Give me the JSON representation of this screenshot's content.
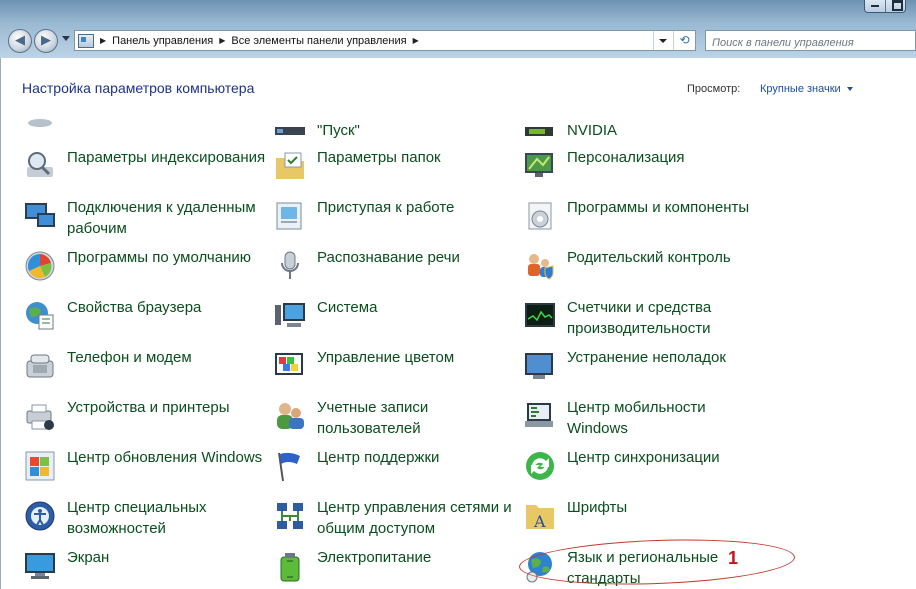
{
  "window": {
    "breadcrumbs": [
      "Панель управления",
      "Все элементы панели управления"
    ],
    "search_placeholder": "Поиск в панели управления"
  },
  "header": {
    "title": "Настройка параметров компьютера",
    "view_label": "Просмотр:",
    "view_value": "Крупные значки"
  },
  "items": [
    {
      "label": "\"Пуск\"",
      "icon": "taskbar-icon"
    },
    {
      "label": "NVIDIA",
      "icon": "nvidia-icon"
    },
    {
      "label": "Параметры индексирования",
      "icon": "indexing-icon"
    },
    {
      "label": "Параметры папок",
      "icon": "folder-options-icon"
    },
    {
      "label": "Персонализация",
      "icon": "personalization-icon"
    },
    {
      "label": "Подключения к удаленным рабочим",
      "icon": "remote-desktop-icon"
    },
    {
      "label": "Приступая к работе",
      "icon": "getting-started-icon"
    },
    {
      "label": "Программы и компоненты",
      "icon": "programs-features-icon"
    },
    {
      "label": "Программы по умолчанию",
      "icon": "default-programs-icon"
    },
    {
      "label": "Распознавание речи",
      "icon": "microphone-icon"
    },
    {
      "label": "Родительский контроль",
      "icon": "parental-control-icon"
    },
    {
      "label": "Свойства браузера",
      "icon": "internet-options-icon"
    },
    {
      "label": "Система",
      "icon": "system-icon"
    },
    {
      "label": "Счетчики и средства производительности",
      "icon": "performance-icon"
    },
    {
      "label": "Телефон и модем",
      "icon": "phone-modem-icon"
    },
    {
      "label": "Управление цветом",
      "icon": "color-management-icon"
    },
    {
      "label": "Устранение неполадок",
      "icon": "troubleshooting-icon"
    },
    {
      "label": "Устройства и принтеры",
      "icon": "devices-printers-icon"
    },
    {
      "label": "Учетные записи пользователей",
      "icon": "user-accounts-icon"
    },
    {
      "label": "Центр мобильности Windows",
      "icon": "mobility-center-icon"
    },
    {
      "label": "Центр обновления Windows",
      "icon": "windows-update-icon"
    },
    {
      "label": "Центр поддержки",
      "icon": "action-center-flag-icon"
    },
    {
      "label": "Центр синхронизации",
      "icon": "sync-center-icon"
    },
    {
      "label": "Центр специальных возможностей",
      "icon": "ease-of-access-icon"
    },
    {
      "label": "Центр управления сетями и общим доступом",
      "icon": "network-center-icon"
    },
    {
      "label": "Шрифты",
      "icon": "fonts-icon"
    },
    {
      "label": "Экран",
      "icon": "display-icon"
    },
    {
      "label": "Электропитание",
      "icon": "power-options-icon"
    },
    {
      "label": "Язык и региональные стандарты",
      "icon": "region-language-icon"
    }
  ],
  "annotation": {
    "number": "1",
    "color": "#c0171b"
  }
}
